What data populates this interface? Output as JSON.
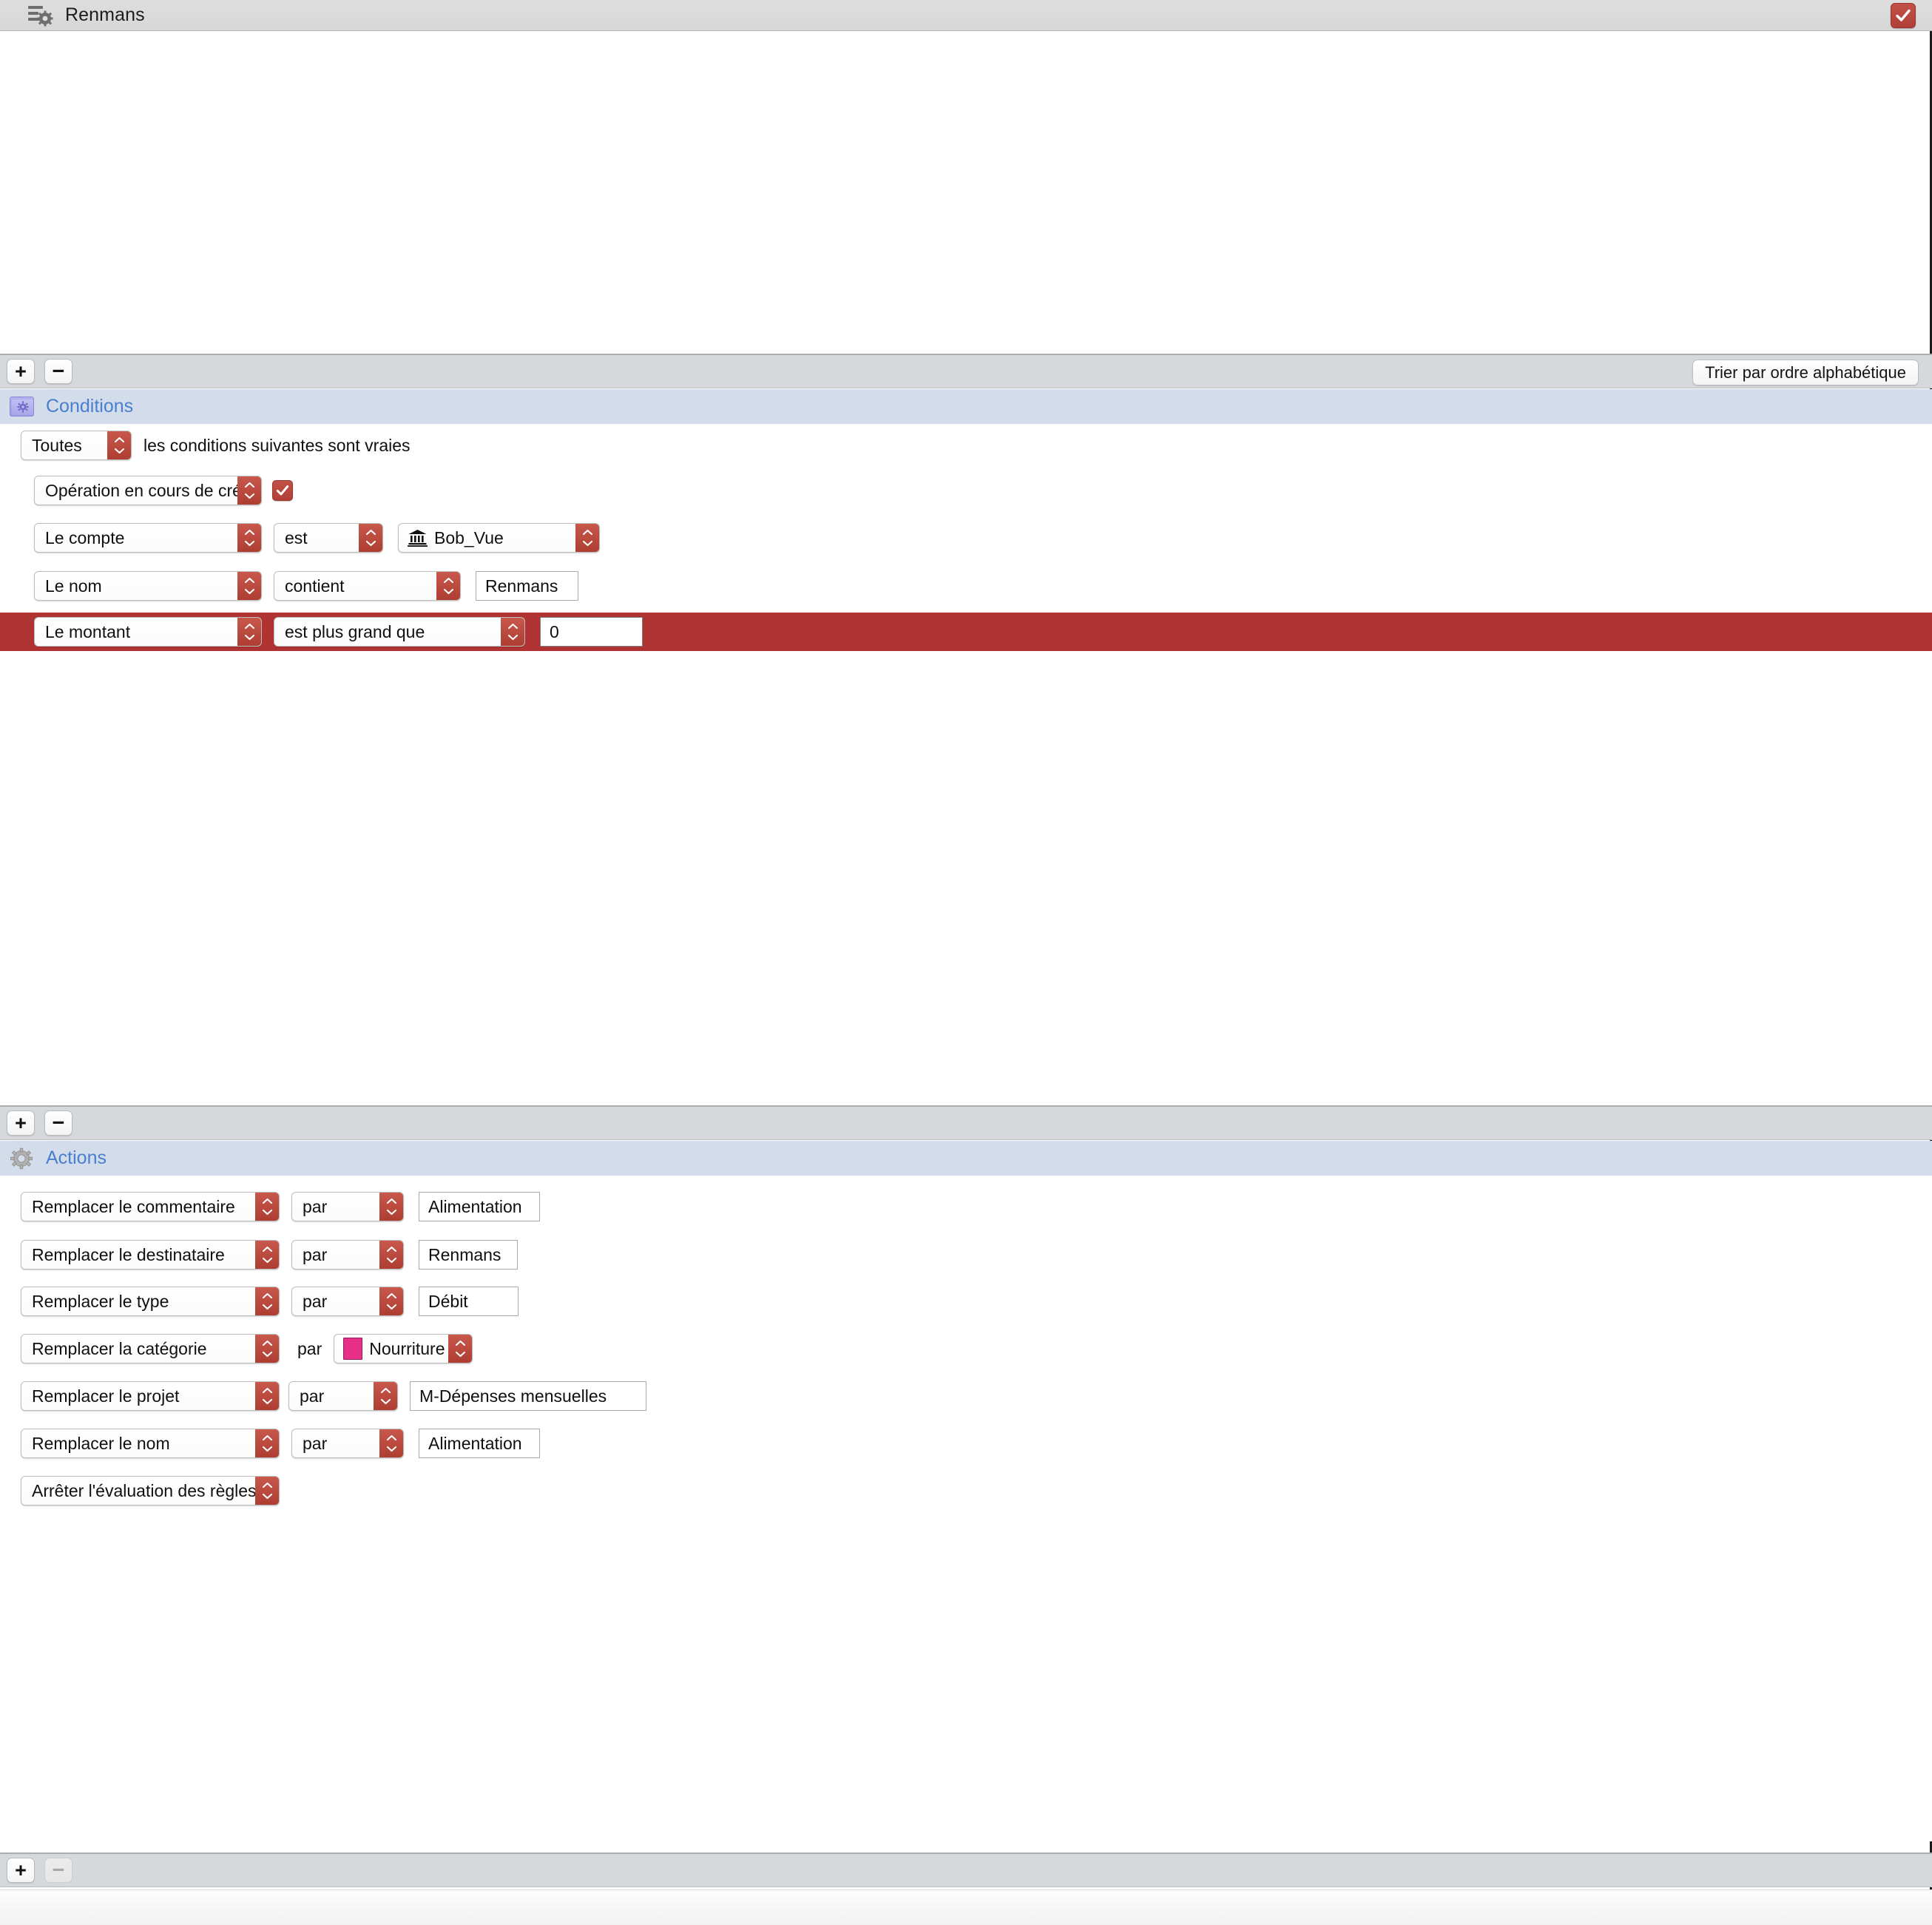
{
  "window": {
    "title": "Renmans",
    "title_icon": "rule-gear-icon",
    "enabled_checkbox": true
  },
  "conditions_toolbar": {
    "add_label": "+",
    "remove_label": "−",
    "sort_label": "Trier par ordre alphabétique"
  },
  "conditions_section": {
    "icon": "folder-gear-icon",
    "label": "Conditions",
    "matcher": {
      "selector_value": "Toutes",
      "sentence": "les conditions suivantes sont vraies"
    },
    "rows": [
      {
        "field": "Opération en cours de création",
        "checkbox": true,
        "selected": false
      },
      {
        "field": "Le compte",
        "operator": "est",
        "value": "Bob_Vue",
        "value_icon": "bank-icon",
        "selected": false
      },
      {
        "field": "Le nom",
        "operator": "contient",
        "value": "Renmans",
        "selected": false
      },
      {
        "field": "Le montant",
        "operator": "est plus grand que",
        "value": "0",
        "selected": true
      }
    ]
  },
  "actions_toolbar": {
    "add_label": "+",
    "remove_label": "−"
  },
  "actions_section": {
    "icon": "gear-icon",
    "label": "Actions",
    "rows": [
      {
        "action": "Remplacer le commentaire",
        "connector": "par",
        "connector_kind": "popup",
        "value": "Alimentation",
        "value_kind": "field"
      },
      {
        "action": "Remplacer le destinataire",
        "connector": "par",
        "connector_kind": "popup",
        "value": "Renmans",
        "value_kind": "field"
      },
      {
        "action": "Remplacer le type",
        "connector": "par",
        "connector_kind": "popup",
        "value": "Débit",
        "value_kind": "field"
      },
      {
        "action": "Remplacer la catégorie",
        "connector": "par",
        "connector_kind": "text",
        "value": "Nourriture",
        "value_kind": "popup",
        "swatch_color": "#e8308a"
      },
      {
        "action": "Remplacer le projet",
        "connector": "par",
        "connector_kind": "popup",
        "value": "M-Dépenses mensuelles",
        "value_kind": "field"
      },
      {
        "action": "Remplacer le nom",
        "connector": "par",
        "connector_kind": "popup",
        "value": "Alimentation",
        "value_kind": "field"
      },
      {
        "action": "Arrêter l'évaluation des règles",
        "connector": null,
        "connector_kind": "none",
        "value": null,
        "value_kind": "none"
      }
    ]
  },
  "bottom_toolbar": {
    "add_label": "+",
    "remove_label": "−",
    "remove_disabled": true
  },
  "colors": {
    "selection": "#b03333",
    "accent_control": "#b03f36",
    "section_header_bg": "#d2dcea",
    "section_label": "#4a7fd0",
    "toolbar_bg": "#d6d9dc",
    "category_swatch": "#e8308a"
  }
}
